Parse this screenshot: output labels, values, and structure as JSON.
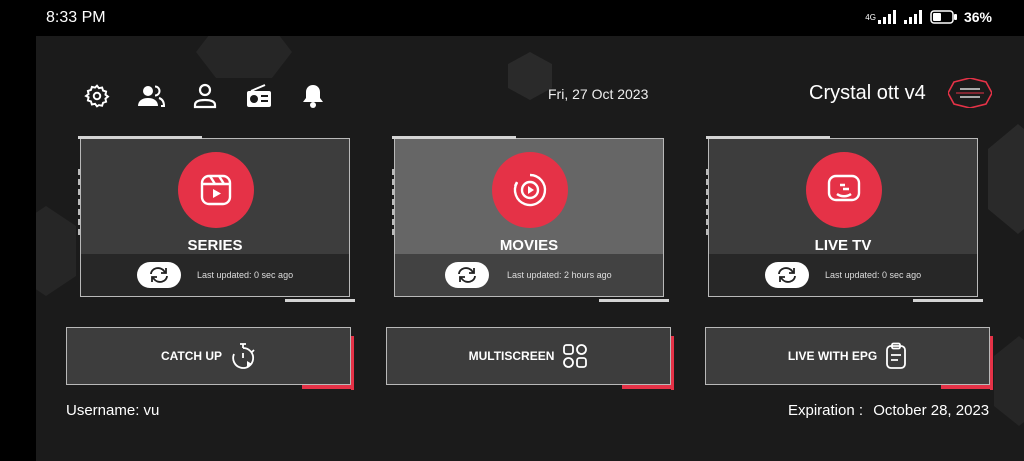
{
  "status_bar": {
    "time": "8:33 PM",
    "network": "4G",
    "battery": "36%"
  },
  "header": {
    "date": "Fri, 27 Oct 2023",
    "brand": "Crystal ott v4",
    "toolbar_icons": [
      "gear-icon",
      "users-icon",
      "user-icon",
      "radio-icon",
      "bell-icon"
    ]
  },
  "cards": [
    {
      "title": "SERIES",
      "updated": "Last updated: 0 sec ago",
      "icon": "reels-icon"
    },
    {
      "title": "MOVIES",
      "updated": "Last updated: 2 hours ago",
      "icon": "play-circle-icon"
    },
    {
      "title": "LIVE TV",
      "updated": "Last updated: 0 sec ago",
      "icon": "tv-icon"
    }
  ],
  "buttons": [
    {
      "label": "CATCH UP",
      "icon": "timer-play-icon"
    },
    {
      "label": "MULTISCREEN",
      "icon": "grid-icon"
    },
    {
      "label": "LIVE WITH EPG",
      "icon": "clipboard-icon"
    }
  ],
  "footer": {
    "username": "Username: vu",
    "expiration_label": "Expiration :",
    "expiration_date": "October 28, 2023"
  },
  "colors": {
    "accent": "#e53247",
    "card_bg": "#3d3d3d",
    "card_active_bg": "#666666",
    "app_bg": "#1b1b1b"
  }
}
